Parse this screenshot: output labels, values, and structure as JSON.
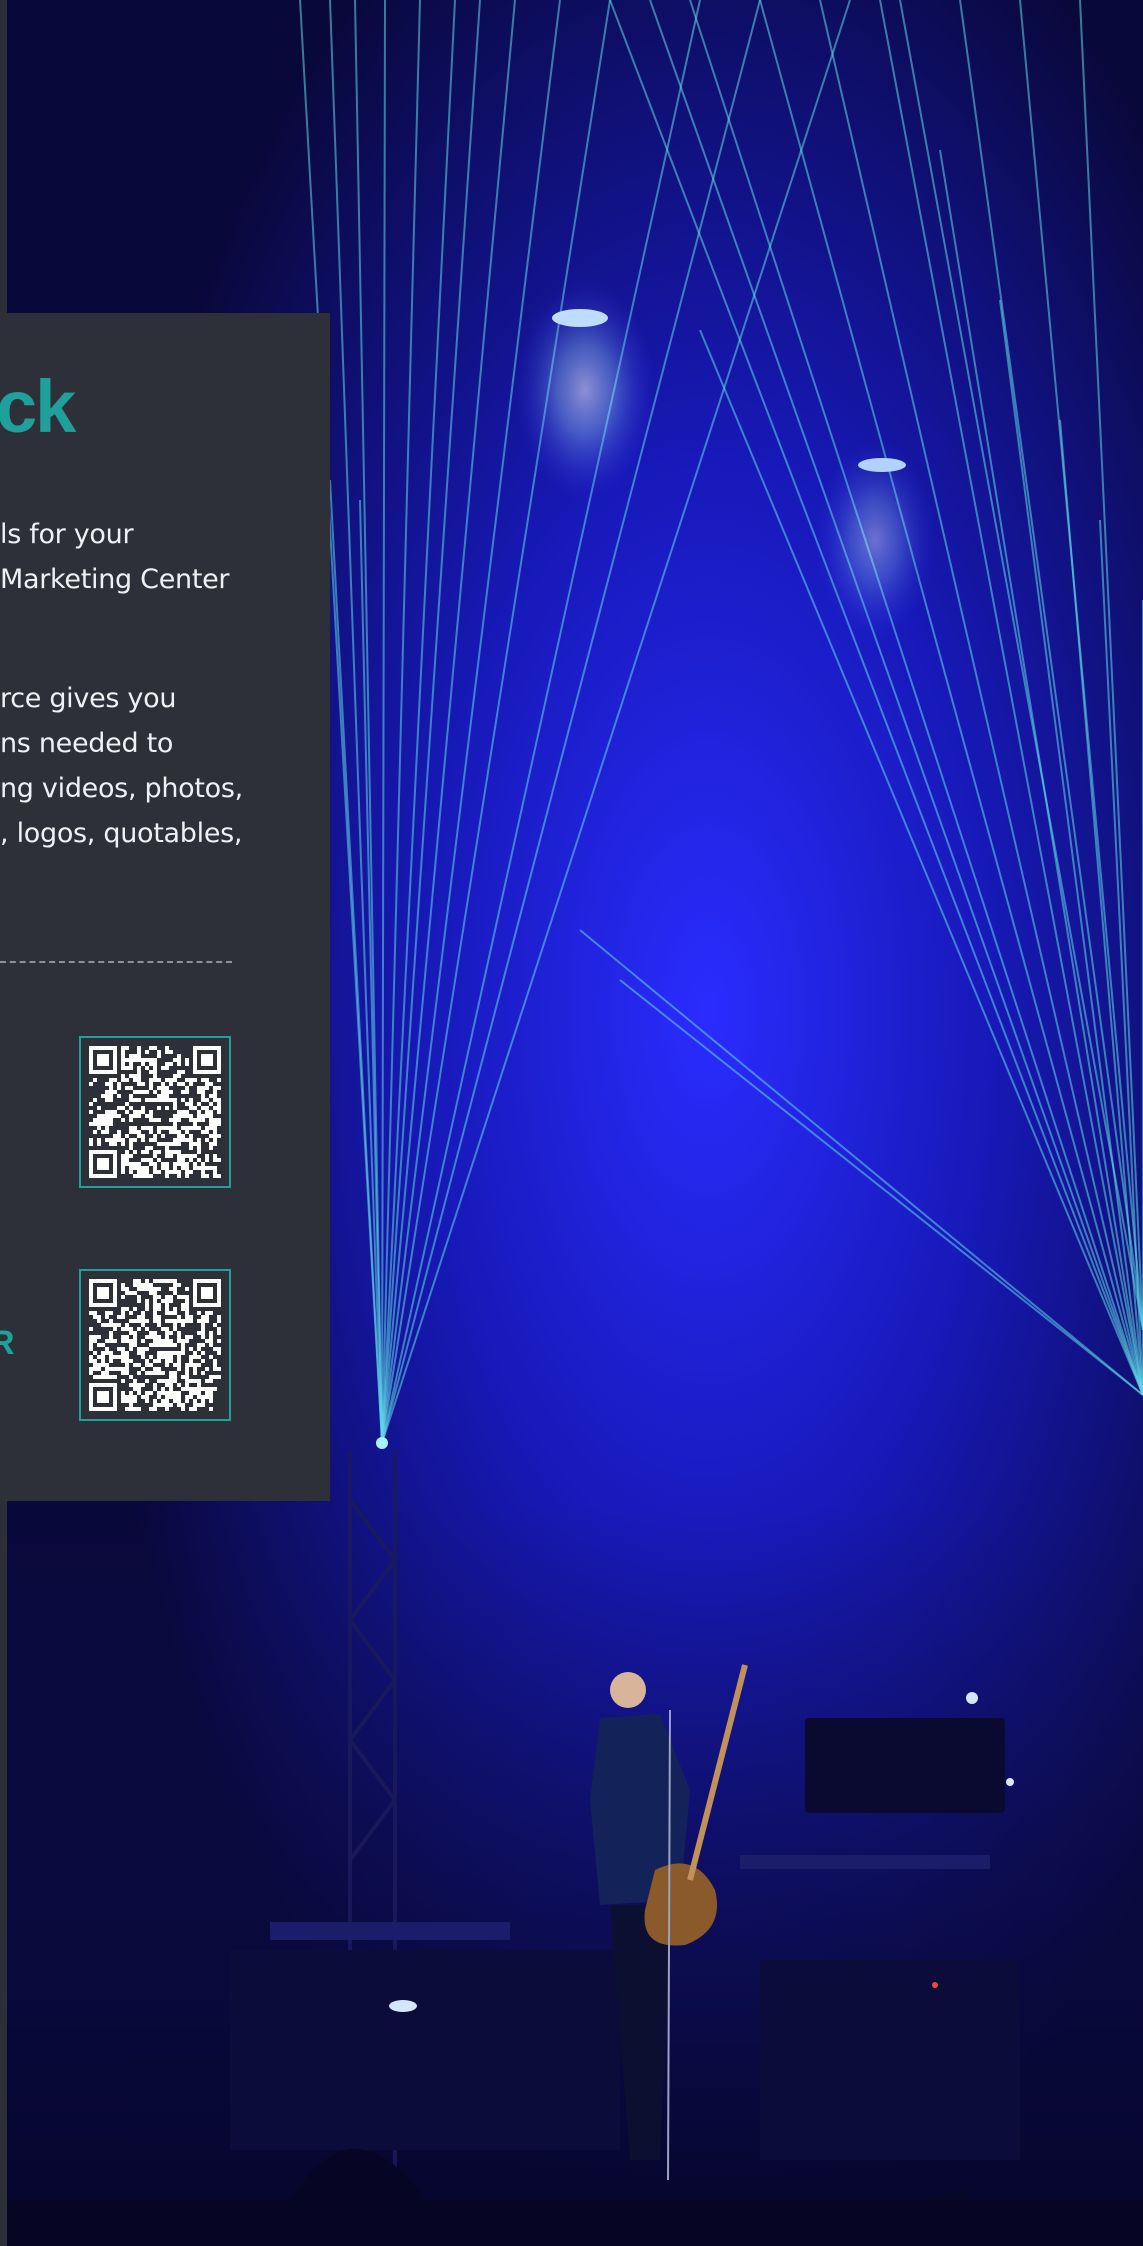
{
  "panel": {
    "title": "ck",
    "intro_lines": [
      "ls for your",
      "Marketing Center"
    ],
    "body_lines": [
      "rce gives you",
      "ns needed to",
      "ng videos, photos,",
      ", logos, quotables,"
    ],
    "qr_codes": [
      {
        "label": "",
        "icon": "qr-code-icon"
      },
      {
        "label": "R",
        "icon": "qr-code-icon"
      }
    ]
  },
  "colors": {
    "accent": "#1fa09b",
    "panel_bg": "#2d3038",
    "text": "#eef0f3",
    "stage_blue": "#1a1ee0",
    "laser": "#5fd9e8"
  }
}
